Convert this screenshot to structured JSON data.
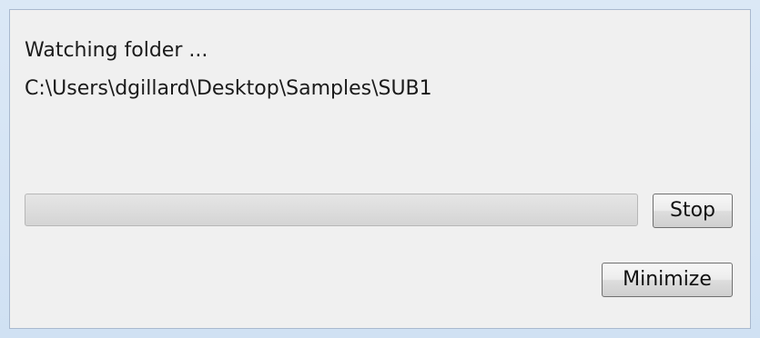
{
  "status": {
    "title": "Watching folder ...",
    "folder_path": "C:\\Users\\dgillard\\Desktop\\Samples\\SUB1"
  },
  "progress": {
    "value_percent": 0
  },
  "buttons": {
    "stop_label": "Stop",
    "minimize_label": "Minimize"
  }
}
